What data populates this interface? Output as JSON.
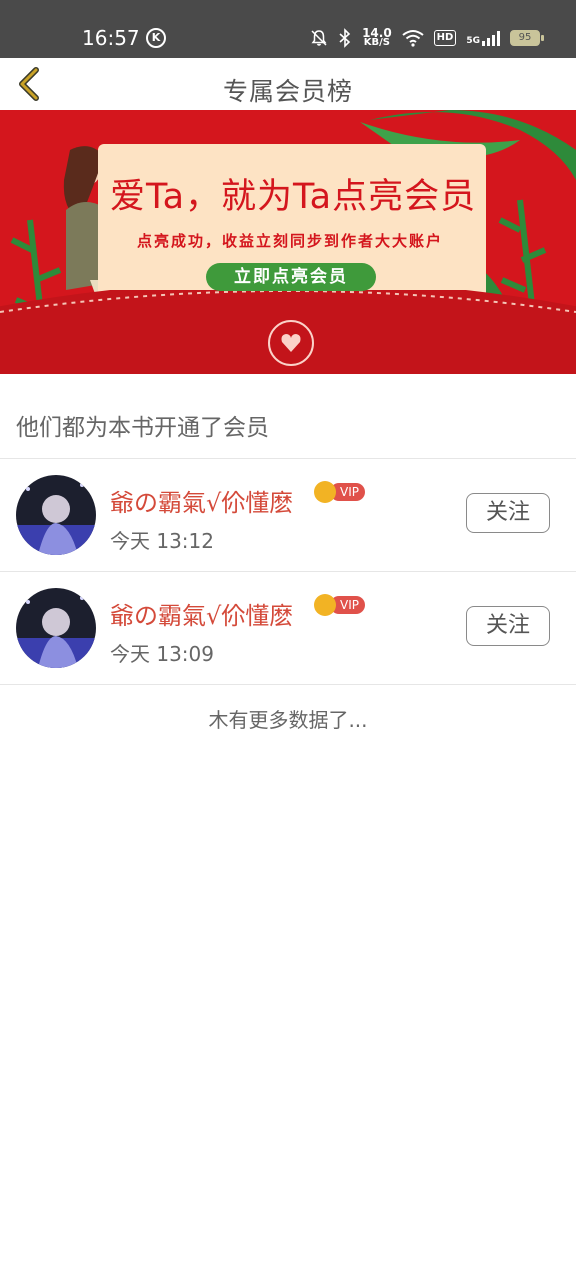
{
  "status_bar": {
    "time": "16:57",
    "k_badge": "K",
    "net_speed_value": "14.0",
    "net_speed_unit": "KB/S",
    "hd_label": "HD",
    "network_label": "5G",
    "battery_level": "95",
    "icons": [
      "mute-bell-icon",
      "bluetooth-icon",
      "wifi-icon",
      "signal-icon",
      "battery-icon"
    ]
  },
  "header": {
    "title": "专属会员榜",
    "back_icon": "chevron-left-icon"
  },
  "banner": {
    "headline": "爱Ta，就为Ta点亮会员",
    "subtitle": "点亮成功，收益立刻同步到作者大大账户",
    "cta_label": "立即点亮会员"
  },
  "section": {
    "title": "他们都为本书开通了会员"
  },
  "members": [
    {
      "name": "爺の霸氣√伱懂麽",
      "badge": "VIP",
      "time": "今天 13:12",
      "follow_label": "关注"
    },
    {
      "name": "爺の霸氣√伱懂麽",
      "badge": "VIP",
      "time": "今天 13:09",
      "follow_label": "关注"
    }
  ],
  "footer": {
    "no_more_text": "木有更多数据了..."
  },
  "colors": {
    "status_bar_bg": "#4a4a4a",
    "banner_red": "#d4161d",
    "username_red": "#d44a3a",
    "cta_green": "#3f9a3b",
    "back_icon": "#c9a227"
  }
}
